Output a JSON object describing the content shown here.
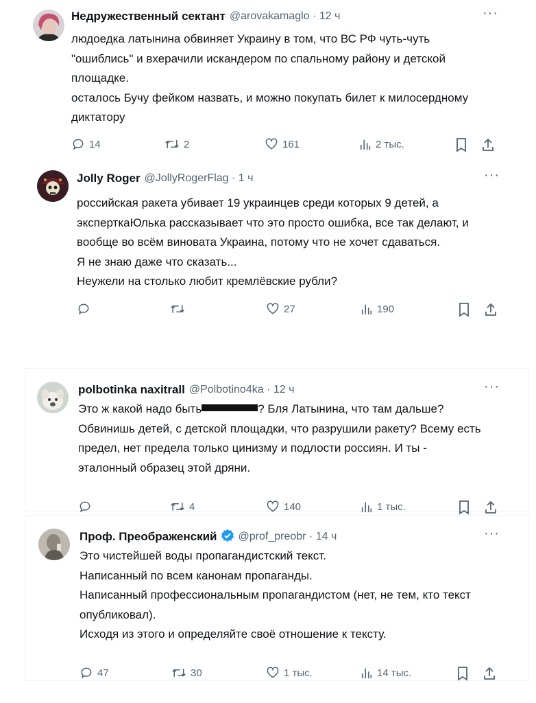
{
  "tweets": [
    {
      "name": "Недружественный сектант",
      "handle": "@arovakamaglo · 12 ч",
      "lines": [
        "людоедка латынина обвиняет Украину в том, что ВС РФ чуть-чуть",
        "\"ошиблись\" и вхерачили искандером по спальному району и детской",
        "площадке.",
        "осталось Бучу фейком назвать, и можно покупать билет к милосердному",
        "диктатору"
      ],
      "replies": "14",
      "reposts": "2",
      "likes": "161",
      "views": "2 тыс."
    },
    {
      "name": "Jolly Roger",
      "handle": "@JollyRogerFlag · 1 ч",
      "lines": [
        "российская ракета убивает 19 украинцев среди которых 9 детей, а",
        "эксперткаЮлька рассказывает что это просто ошибка, все так делают, и",
        "вообще во всём виновата Украина, потому что не хочет сдаваться.",
        "Я не знаю даже что сказать...",
        "Неужели на столько любит кремлёвские рубли?"
      ],
      "replies": "",
      "reposts": "",
      "likes": "27",
      "views": "190"
    },
    {
      "name": "polbotinka naxitrall",
      "handle": "@Polbotino4ka · 12 ч",
      "line1_before": "Это ж какой надо быть",
      "line1_after": "? Бля Латынина, что там дальше?",
      "lines": [
        "Обвинишь детей, с детской площадки, что разрушили ракету? Всему есть",
        "предел, нет предела только цинизму и подлости россиян. И ты -",
        "эталонный образец этой дряни."
      ],
      "replies": "",
      "reposts": "4",
      "likes": "140",
      "views": "1 тыс."
    },
    {
      "name": "Проф. Преображенский",
      "handle": "@prof_preobr · 14 ч",
      "lines": [
        "Это чистейшей воды пропагандистский текст.",
        "Написанный по всем канонам пропаганды.",
        "Написанный профессиональным пропагандистом (нет, не тем, кто текст",
        "опубликовал).",
        "Исходя из этого и определяйте своё отношение к тексту."
      ],
      "replies": "47",
      "reposts": "30",
      "likes": "1 тыс.",
      "views": "14 тыс."
    }
  ],
  "colors": {
    "text": "#0f1419",
    "secondary": "#536471",
    "verified": "#1d9bf0",
    "border": "#eff3f4"
  },
  "icons": [
    "reply-icon",
    "repost-icon",
    "like-icon",
    "views-icon",
    "bookmark-icon",
    "share-icon",
    "more-icon",
    "verified-badge-icon"
  ]
}
